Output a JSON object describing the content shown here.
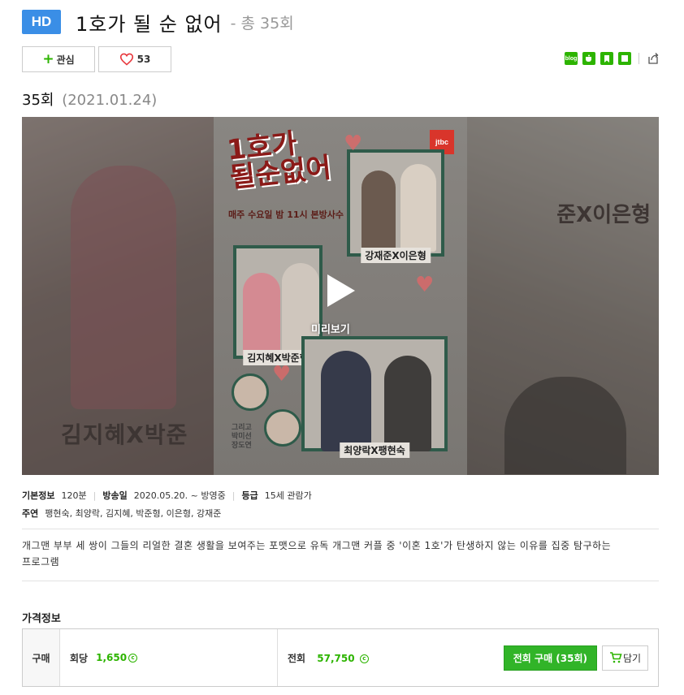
{
  "header": {
    "badge": "HD",
    "title": "1호가 될 순 없어",
    "subtitle": "- 총 35회"
  },
  "actions": {
    "interest_label": "관심",
    "like_count": "53"
  },
  "share": {
    "icons": [
      "blog-icon",
      "cafe-icon",
      "bookmark-icon",
      "memo-icon",
      "share-icon"
    ],
    "blog_text": "blog"
  },
  "episode": {
    "number": "35회",
    "date": "(2021.01.24)"
  },
  "player": {
    "preview_label": "미리보기",
    "poster": {
      "network": "jtbc",
      "logo_title_line1": "1호가",
      "logo_title_line2": "될순없어",
      "tagline": "매주 수요일 밤 11시 본방사수",
      "couple1": "강재준X이은형",
      "couple2": "김지혜X박준형",
      "couple3": "최양락X팽현숙",
      "extra_line1": "그리고",
      "extra_line2": "박미선",
      "extra_line3": "장도연"
    },
    "bg_left_text": "김지혜X박준",
    "bg_right_text": "준X이은형"
  },
  "info": {
    "basic_label": "기본정보",
    "runtime": "120분",
    "air_label": "방송일",
    "air_date": "2020.05.20. ~ 방영중",
    "rating_label": "등급",
    "rating": "15세 관람가",
    "cast_label": "주연",
    "cast": "팽현숙, 최양락, 김지혜, 박준형, 이은형, 강재준"
  },
  "description": "개그맨 부부 세 쌍이 그들의 리얼한 결혼 생활을 보여주는 포맷으로 유독 개그맨 커플 중 '이혼 1호'가 탄생하지 않는 이유를 집중 탐구하는 프로그램",
  "price": {
    "section_title": "가격정보",
    "row_label": "구매",
    "per_episode_label": "회당",
    "per_episode_price": "1,650",
    "all_label": "전회",
    "all_price": "57,750",
    "coin_symbol": "c",
    "buy_all_button": "전회 구매 (35회)",
    "cart_button": "담기"
  },
  "colors": {
    "accent_green": "#2db400",
    "hd_blue": "#3a8ee6",
    "heart_red": "#e8383d"
  }
}
